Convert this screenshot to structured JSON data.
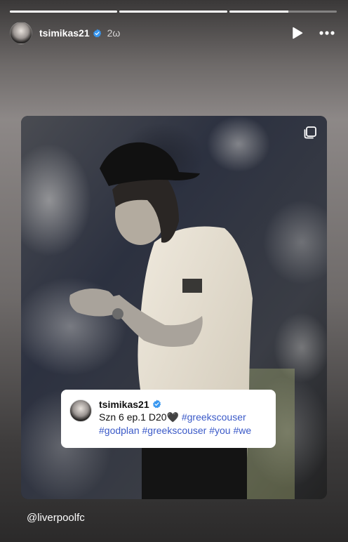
{
  "progress": [
    1,
    1,
    0.55
  ],
  "header": {
    "username": "tsimikas21",
    "timestamp": "2ω"
  },
  "caption": {
    "username": "tsimikas21",
    "text_prefix": "Szn 6 ep.1 D20🖤 ",
    "hashtags": [
      "#greekscouser",
      "#godplan",
      "#greekscouser",
      "#you",
      "#we"
    ]
  },
  "mention": "@liverpoolfc",
  "colors": {
    "verified_badge": "#3897f0",
    "hashtag": "#3b5ac8"
  },
  "icons": {
    "play": "play-icon",
    "more": "more-horizontal-icon",
    "multi": "multiple-photos-icon",
    "verified": "verified-badge-icon"
  }
}
